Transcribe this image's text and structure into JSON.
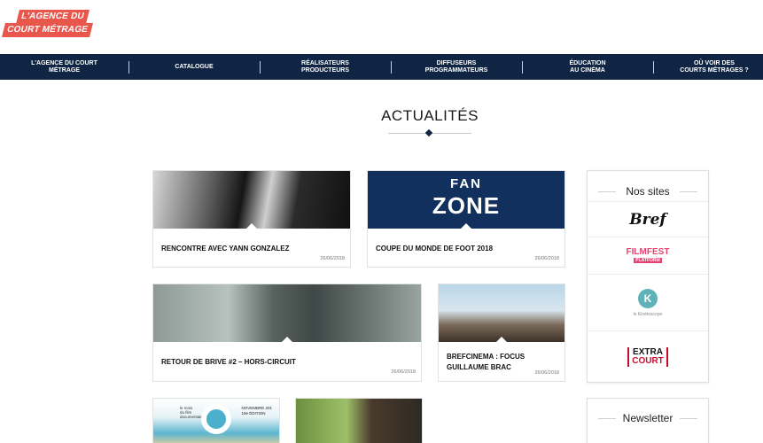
{
  "logo": {
    "line1": "L'AGENCE DU",
    "line2": "COURT MÉTRAGE"
  },
  "nav": {
    "items": [
      {
        "label": "L'AGENCE DU COURT\nMÉTRAGE"
      },
      {
        "label": "CATALOGUE"
      },
      {
        "label": "RÉALISATEURS\nPRODUCTEURS"
      },
      {
        "label": "DIFFUSEURS\nPROGRAMMATEURS"
      },
      {
        "label": "ÉDUCATION\nAU CINÉMA"
      },
      {
        "label": "OÙ VOIR DES\nCOURTS MÉTRAGES ?"
      }
    ]
  },
  "page": {
    "title": "ACTUALITÉS"
  },
  "articles": [
    {
      "title": "RENCONTRE AVEC YANN GONZALEZ",
      "date": "26/06/2018"
    },
    {
      "title": "COUPE DU MONDE DE FOOT 2018",
      "date": "26/06/2018",
      "image_text_top": "FAN",
      "image_text_bottom": "ZONE"
    },
    {
      "title": "RETOUR DE BRIVE #2 – HORS-CIRCUIT",
      "date": "26/06/2018"
    },
    {
      "title": "BREFCINEMA : FOCUS GUILLAUME BRAC",
      "date": "26/06/2018"
    },
    {
      "image_text": "le mois\ndu film\ndocumentaire",
      "image_badge": "NOVEMBRE 201\n19e ÉDITION"
    },
    {}
  ],
  "sidebar": {
    "sites_heading": "Nos sites",
    "sites": [
      {
        "name": "Bref",
        "icon": "bref-logo"
      },
      {
        "name_top": "FILMFEST",
        "name_bottom": "PLATFORM",
        "icon": "filmfest-logo"
      },
      {
        "icon_letter": "K",
        "name": "le Kinétoscope",
        "icon": "kinetoscope-logo"
      },
      {
        "name_top": "EXTRA",
        "name_bottom": "COURT",
        "icon": "extra-court-logo"
      }
    ],
    "newsletter_heading": "Newsletter"
  },
  "colors": {
    "nav_bg": "#0f2543",
    "logo_red": "#e8564c",
    "accent_pink": "#e64470",
    "extra_red": "#c8102e"
  }
}
